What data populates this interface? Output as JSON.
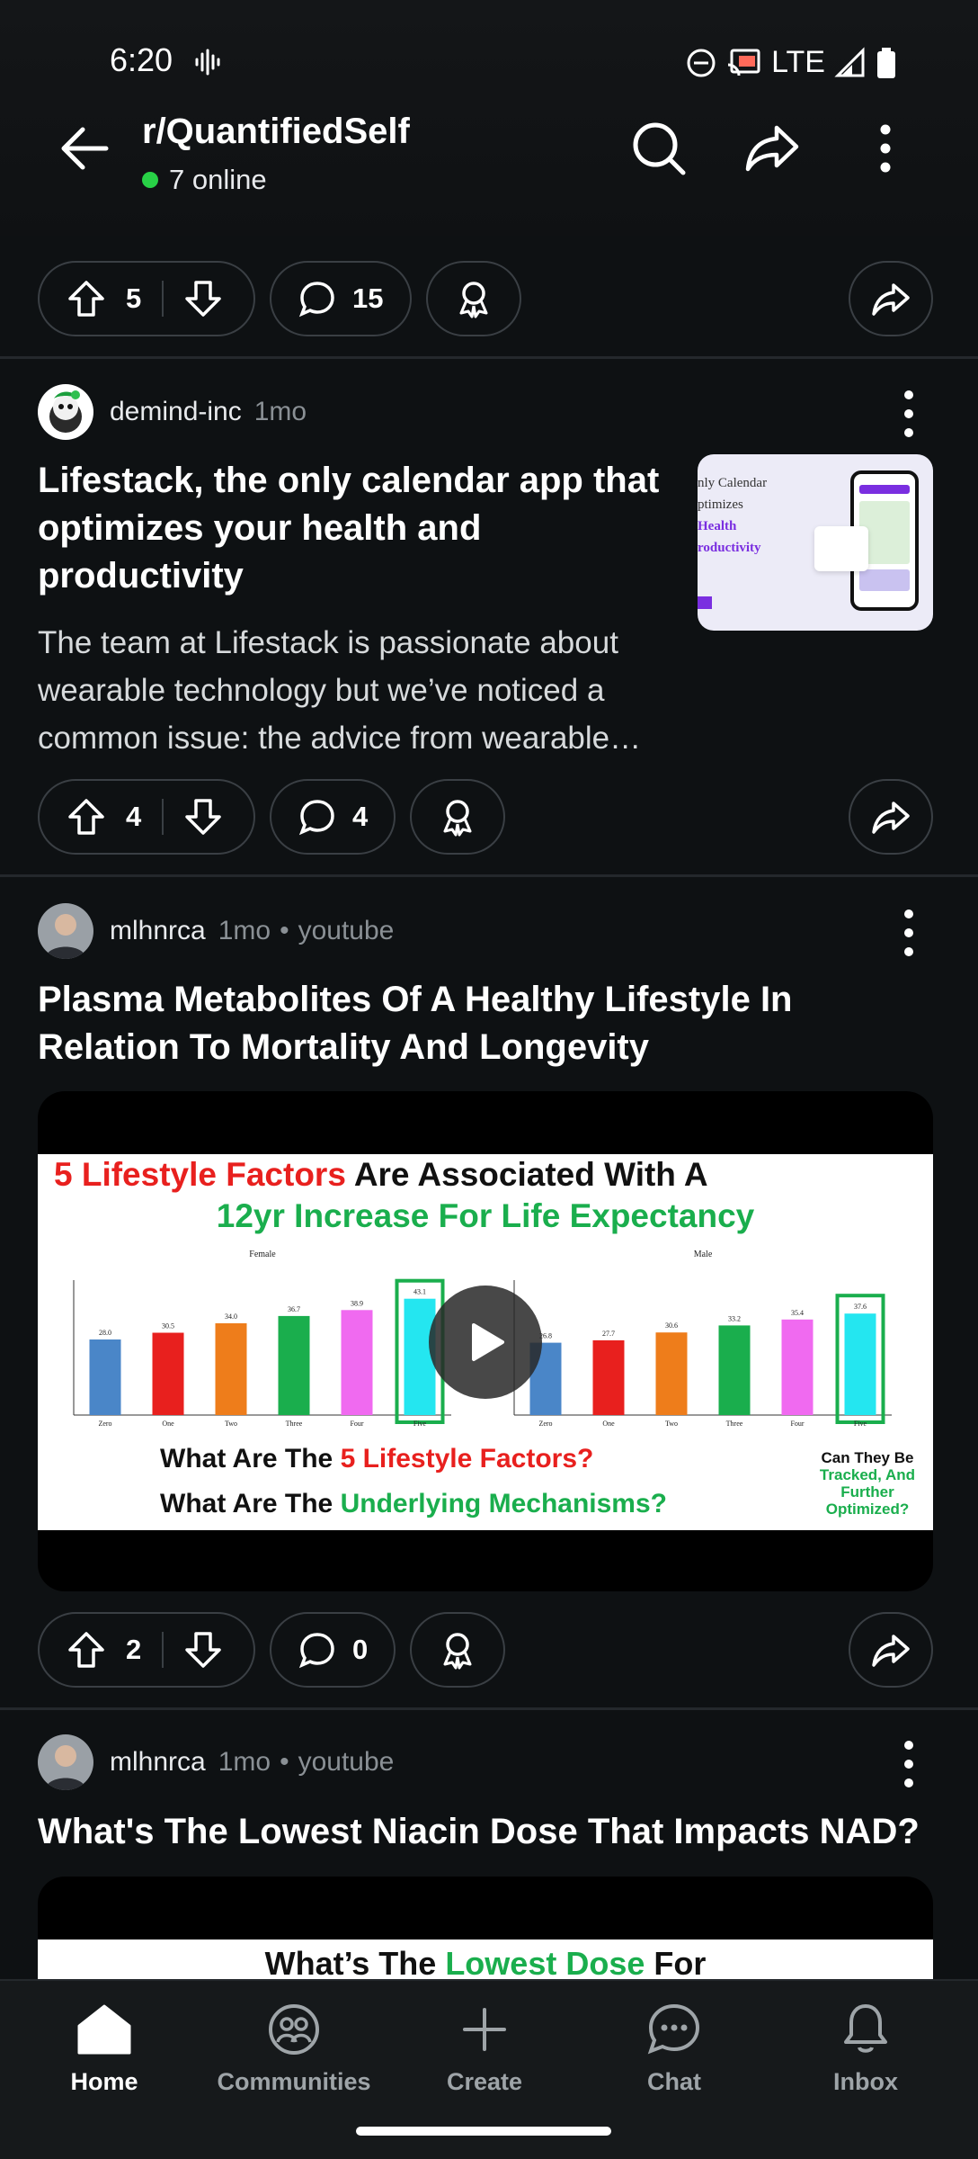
{
  "status_bar": {
    "time": "6:20",
    "network": "LTE"
  },
  "header": {
    "subreddit": "r/QuantifiedSelf",
    "online": "7 online"
  },
  "top_actions": {
    "upvotes": "5",
    "comments": "15"
  },
  "posts": [
    {
      "author": "demind-inc",
      "age": "1mo",
      "title": "Lifestack, the only calendar app that optimizes your health and productivity",
      "body": "The team at Lifestack is passionate about wearable technology but we’ve noticed a common issue: the advice from wearable…",
      "thumb_lines": [
        "nly Calendar",
        "ptimizes",
        "Health",
        "roductivity"
      ],
      "upvotes": "4",
      "comments": "4"
    },
    {
      "author": "mlhnrca",
      "age": "1mo",
      "source": "youtube",
      "title": "Plasma Metabolites Of A Healthy Lifestyle In Relation To Mortality And Longevity",
      "video": {
        "line1_red": "5 Lifestyle Factors",
        "line1_black": " Are Associated With A",
        "line2_green": "12yr Increase For Life Expectancy",
        "chart_female_title": "Female",
        "chart_male_title": "Male",
        "q1_black": "What Are The ",
        "q1_red": "5 Lifestyle Factors?",
        "q2_black": "What Are The ",
        "q2_green": "Underlying Mechanisms?",
        "side_black": "Can They Be",
        "side_green1": "Tracked, And",
        "side_green2": "Further",
        "side_green3": "Optimized?"
      },
      "upvotes": "2",
      "comments": "0"
    },
    {
      "author": "mlhnrca",
      "age": "1mo",
      "source": "youtube",
      "title": "What's The Lowest Niacin Dose That Impacts NAD?",
      "video": {
        "line_black": "What’s The ",
        "line_green": "Lowest Dose",
        "line_black2": " For"
      }
    }
  ],
  "chart_data": {
    "type": "bar",
    "categories": [
      "Zero",
      "One",
      "Two",
      "Three",
      "Four",
      "Five"
    ],
    "series": [
      {
        "name": "Female",
        "values": [
          28.0,
          30.5,
          34.0,
          36.7,
          38.9,
          43.1
        ]
      },
      {
        "name": "Male",
        "values": [
          26.8,
          27.7,
          30.6,
          33.2,
          35.4,
          37.6
        ]
      }
    ],
    "ylim": [
      0,
      50
    ],
    "colors": [
      "#4a86c8",
      "#e8201e",
      "#ee7d1b",
      "#1aae4d",
      "#f06af0",
      "#24e6f0"
    ]
  },
  "nav": [
    {
      "label": "Home",
      "icon": "home-icon",
      "active": true
    },
    {
      "label": "Communities",
      "icon": "communities-icon",
      "active": false
    },
    {
      "label": "Create",
      "icon": "plus-icon",
      "active": false
    },
    {
      "label": "Chat",
      "icon": "chat-icon",
      "active": false
    },
    {
      "label": "Inbox",
      "icon": "bell-icon",
      "active": false
    }
  ]
}
